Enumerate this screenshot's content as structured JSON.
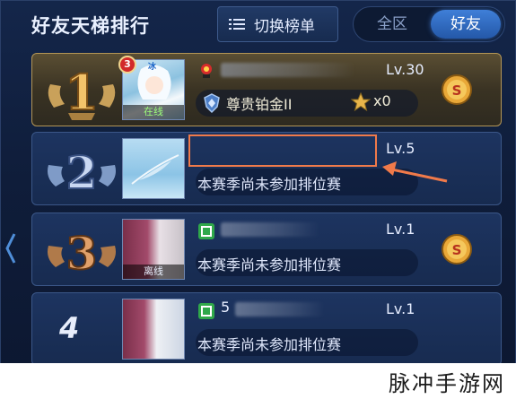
{
  "header": {
    "title": "好友天梯排行",
    "switch_button_label": "切换榜单",
    "tabs": [
      {
        "label": "全区",
        "active": false
      },
      {
        "label": "好友",
        "active": true
      }
    ]
  },
  "rows": [
    {
      "rank": "1",
      "level_badge": "3",
      "avatar_status": "在线",
      "level": "Lv.30",
      "tier": "尊贵铂金II",
      "stars": "x0",
      "has_gift": true
    },
    {
      "rank": "2",
      "level": "Lv.5",
      "season_text": "本赛季尚未参加排位赛",
      "has_gift": false
    },
    {
      "rank": "3",
      "avatar_status": "离线",
      "level": "Lv.1",
      "season_text": "本赛季尚未参加排位赛",
      "has_gift": true
    },
    {
      "rank": "4",
      "name_prefix": "5",
      "level": "Lv.1",
      "season_text": "本赛季尚未参加排位赛",
      "has_gift": false
    }
  ],
  "watermark": "脉冲手游网",
  "colors": {
    "accent_blue": "#2f6cc4",
    "gold_border": "#b49656",
    "highlight_box": "#f07a4a"
  }
}
